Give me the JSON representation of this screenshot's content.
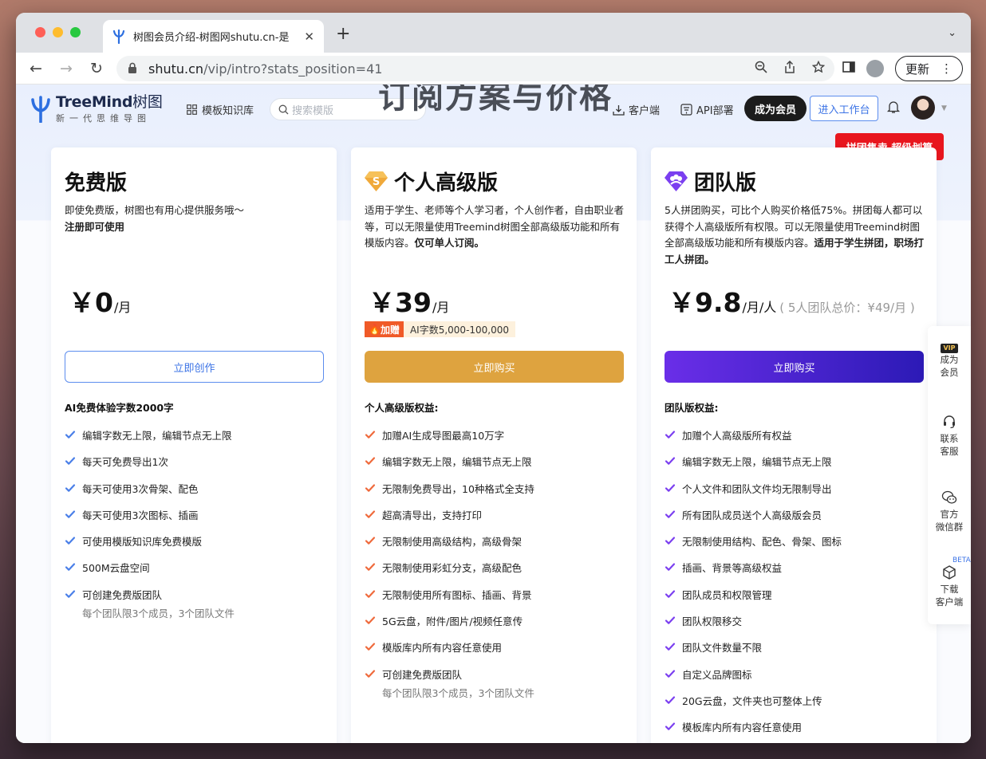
{
  "browser": {
    "tab_title": "树图会员介绍-树图网shutu.cn-是",
    "url_host": "shutu.cn",
    "url_path": "/vip/intro?stats_position=41",
    "update_label": "更新"
  },
  "header": {
    "logo_name": "TreeMind",
    "logo_cn": "树图",
    "logo_slogan": "新一代思维导图",
    "nav_templates": "模板知识库",
    "search_placeholder": "搜索模版",
    "page_title": "订阅方案与价格",
    "client_link": "客户端",
    "api_link": "API部署",
    "member_button": "成为会员",
    "workspace_button": "进入工作台"
  },
  "promo_badge": "拼团售卖 超级划算",
  "plans": {
    "free": {
      "name": "免费版",
      "desc_line1": "即使免费版，树图也有用心提供服务哦～",
      "desc_bold": "注册即可使用",
      "price": "￥0",
      "unit": "/月",
      "cta": "立即创作",
      "benefit_title": "AI免费体验字数2000字",
      "benefits": [
        "编辑字数无上限，编辑节点无上限",
        "每天可免费导出1次",
        "每天可使用3次骨架、配色",
        "每天可使用3次图标、插画",
        "可使用模版知识库免费模版",
        "500M云盘空间",
        "可创建免费版团队"
      ],
      "benefit_sub": "每个团队限3个成员，3个团队文件"
    },
    "pro": {
      "name": "个人高级版",
      "desc": "适用于学生、老师等个人学习者，个人创作者，自由职业者等，可以无限量使用Treemind树图全部高级版功能和所有模版内容。",
      "desc_bold": "仅可单人订阅。",
      "price": "￥39",
      "unit": "/月",
      "gift_tag": "加赠",
      "gift_text": "AI字数5,000-100,000",
      "cta": "立即购买",
      "benefit_title": "个人高级版权益:",
      "benefits": [
        "加赠AI生成导图最高10万字",
        "编辑字数无上限，编辑节点无上限",
        "无限制免费导出，10种格式全支持",
        "超高清导出，支持打印",
        "无限制使用高级结构，高级骨架",
        "无限制使用彩虹分支，高级配色",
        "无限制使用所有图标、插画、背景",
        "5G云盘，附件/图片/视频任意传",
        "模版库内所有内容任意使用",
        "可创建免费版团队"
      ],
      "benefit_sub": "每个团队限3个成员，3个团队文件"
    },
    "team": {
      "name": "团队版",
      "desc": "5人拼团购买，可比个人购买价格低75%。拼团每人都可以获得个人高级版所有权限。可以无限量使用Treemind树图全部高级版功能和所有模版内容。",
      "desc_bold": "适用于学生拼团，职场打工人拼团。",
      "price": "￥9.8",
      "unit": "/月/人",
      "extra": "( 5人团队总价：¥49/月 )",
      "cta": "立即购买",
      "benefit_title": "团队版权益:",
      "benefits": [
        "加赠个人高级版所有权益",
        "编辑字数无上限，编辑节点无上限",
        "个人文件和团队文件均无限制导出",
        "所有团队成员送个人高级版会员",
        "无限制使用结构、配色、骨架、图标",
        "插画、背景等高级权益",
        "团队成员和权限管理",
        "团队权限移交",
        "团队文件数量不限",
        "自定义品牌图标",
        "20G云盘，文件夹也可整体上传",
        "模板库内所有内容任意使用"
      ]
    }
  },
  "sidebar": {
    "vip_badge": "VIP",
    "become_l1": "成为",
    "become_l2": "会员",
    "support_l1": "联系",
    "support_l2": "客服",
    "wechat_l1": "官方",
    "wechat_l2": "微信群",
    "beta": "BETA",
    "download_l1": "下载",
    "download_l2": "客户端"
  },
  "colors": {
    "free_check": "#4a7fe8",
    "pro_check": "#ef6a3c",
    "team_check": "#7b3ff0",
    "pro_cta": "#dea33f",
    "promo": "#e8161e"
  }
}
